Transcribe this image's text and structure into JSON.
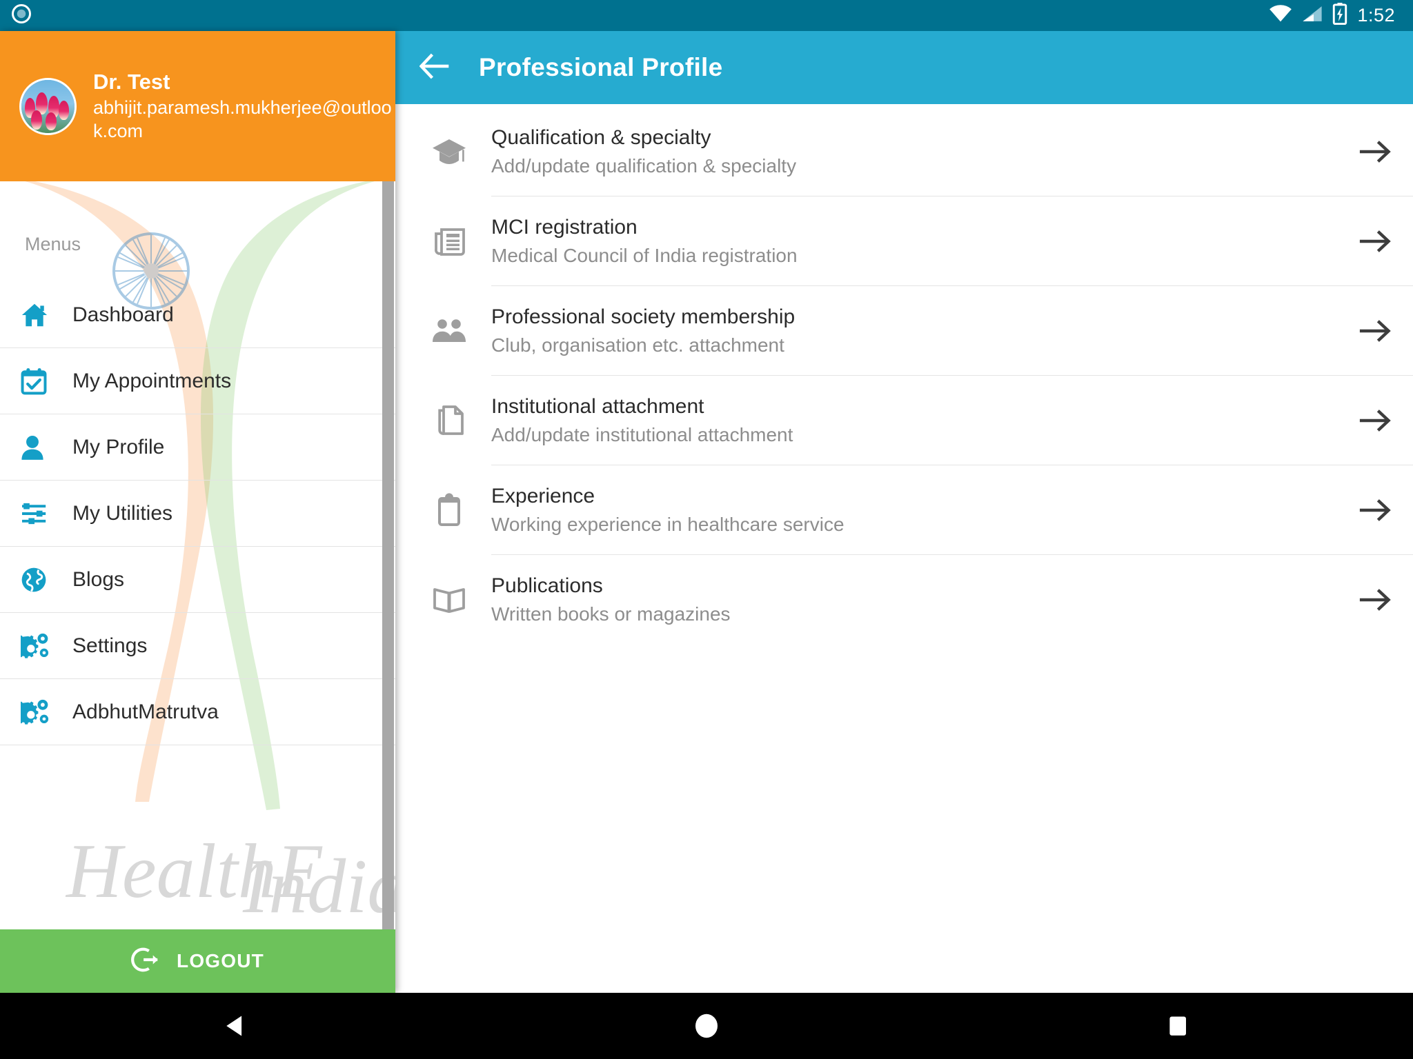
{
  "status_bar": {
    "time": "1:52",
    "notification_icon": "circle-notification-icon",
    "wifi_icon": "wifi-icon",
    "signal_icon": "cellular-signal-icon",
    "battery_icon": "battery-charging-icon",
    "background_color": "#00718f"
  },
  "drawer": {
    "user_name": "Dr. Test",
    "user_email": "abhijit.paramesh.mukherjee@outlook.com",
    "avatar_icon": "user-avatar-tulips-photo",
    "header_color": "#f7941e",
    "section_label": "Menus",
    "watermark_text": "HealthE India",
    "items": [
      {
        "label": "Dashboard",
        "icon": "home-icon"
      },
      {
        "label": "My Appointments",
        "icon": "calendar-check-icon"
      },
      {
        "label": "My Profile",
        "icon": "person-icon"
      },
      {
        "label": "My Utilities",
        "icon": "sliders-icon"
      },
      {
        "label": "Blogs",
        "icon": "globe-icon"
      },
      {
        "label": "Settings",
        "icon": "gears-icon"
      },
      {
        "label": "AdbhutMatrutva",
        "icon": "gears-icon"
      }
    ],
    "logout_label": "LOGOUT",
    "logout_icon": "sign-out-icon",
    "logout_color": "#6dc25b"
  },
  "appbar": {
    "title": "Professional Profile",
    "back_icon": "back-arrow-icon",
    "background_color": "#26abd0"
  },
  "list": {
    "rows": [
      {
        "title": "Qualification & specialty",
        "subtitle": "Add/update qualification & specialty",
        "icon": "graduation-cap-icon",
        "arrow": "arrow-right-icon"
      },
      {
        "title": "MCI registration",
        "subtitle": "Medical Council of India registration",
        "icon": "newspaper-icon",
        "arrow": "arrow-right-icon"
      },
      {
        "title": "Professional society membership",
        "subtitle": "Club, organisation etc. attachment",
        "icon": "people-group-icon",
        "arrow": "arrow-right-icon"
      },
      {
        "title": "Institutional attachment",
        "subtitle": "Add/update institutional attachment",
        "icon": "document-icon",
        "arrow": "arrow-right-icon"
      },
      {
        "title": "Experience",
        "subtitle": "Working experience in healthcare service",
        "icon": "clipboard-icon",
        "arrow": "arrow-right-icon"
      },
      {
        "title": "Publications",
        "subtitle": "Written books or magazines",
        "icon": "open-book-icon",
        "arrow": "arrow-right-icon"
      }
    ]
  },
  "navbar": {
    "back_icon": "android-back-icon",
    "home_icon": "android-home-icon",
    "recents_icon": "android-recents-icon",
    "background_color": "#000000"
  }
}
